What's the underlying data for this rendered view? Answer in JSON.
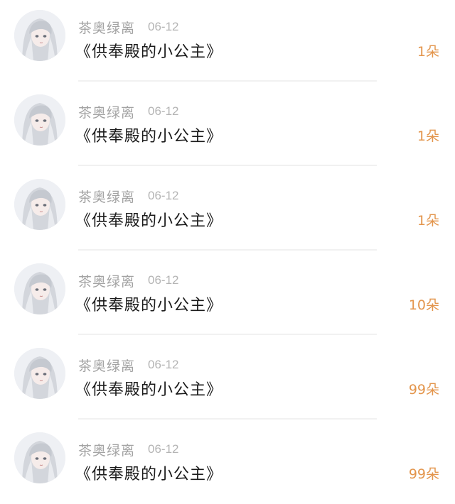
{
  "records": [
    {
      "user": "茶奥绿离",
      "date": "06-12",
      "book": "《供奉殿的小公主》",
      "gift": "1朵",
      "avatar_icon": "anime-girl-avatar-icon"
    },
    {
      "user": "茶奥绿离",
      "date": "06-12",
      "book": "《供奉殿的小公主》",
      "gift": "1朵",
      "avatar_icon": "anime-girl-avatar-icon"
    },
    {
      "user": "茶奥绿离",
      "date": "06-12",
      "book": "《供奉殿的小公主》",
      "gift": "1朵",
      "avatar_icon": "anime-girl-avatar-icon"
    },
    {
      "user": "茶奥绿离",
      "date": "06-12",
      "book": "《供奉殿的小公主》",
      "gift": "10朵",
      "avatar_icon": "anime-girl-avatar-icon"
    },
    {
      "user": "茶奥绿离",
      "date": "06-12",
      "book": "《供奉殿的小公主》",
      "gift": "99朵",
      "avatar_icon": "anime-girl-avatar-icon"
    },
    {
      "user": "茶奥绿离",
      "date": "06-12",
      "book": "《供奉殿的小公主》",
      "gift": "99朵",
      "avatar_icon": "anime-girl-avatar-icon"
    }
  ],
  "colors": {
    "gift": "#e3954c",
    "name": "#a3a3a3",
    "title": "#1b1b1b",
    "divider": "#f1f1f1"
  }
}
